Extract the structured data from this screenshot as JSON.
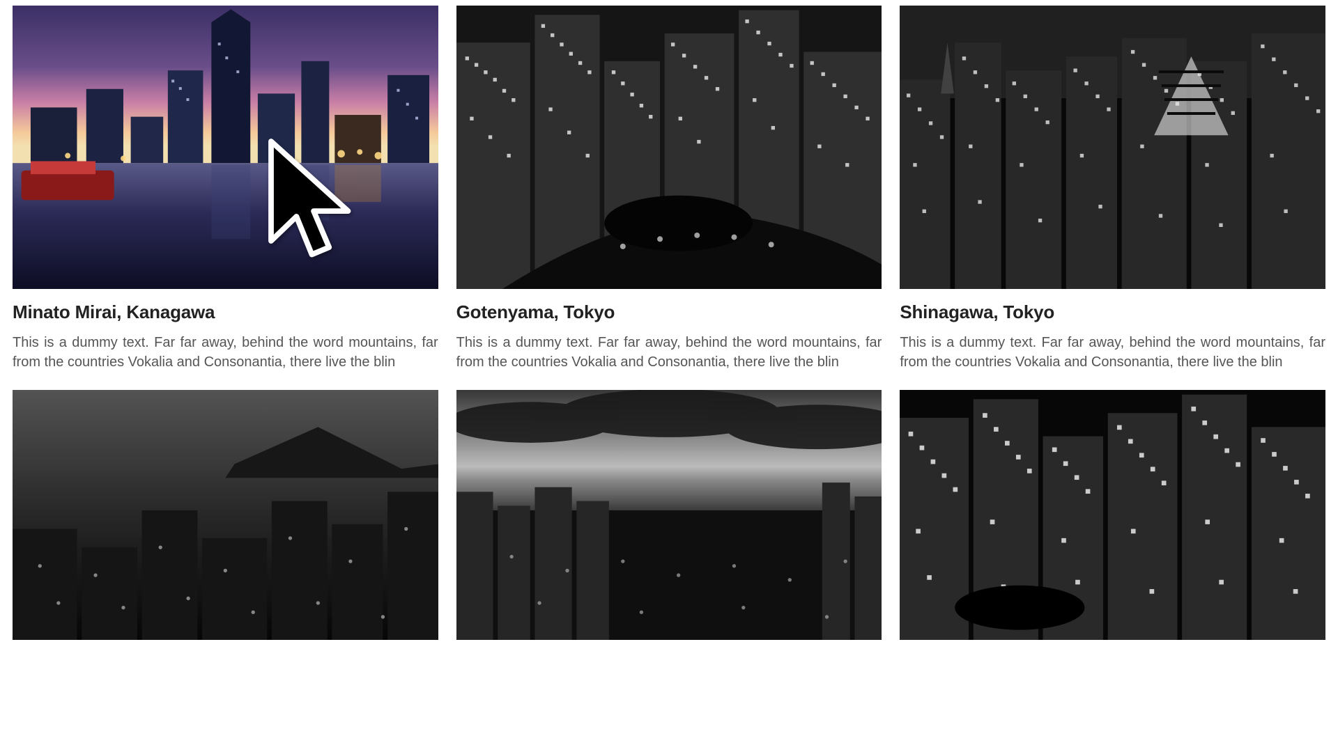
{
  "cards": [
    {
      "title": "Minato Mirai, Kanagawa",
      "desc": "This is a dummy text. Far far away, behind the word mountains, far from the countries Vokalia and Consonantia, there live the blin"
    },
    {
      "title": "Gotenyama, Tokyo",
      "desc": "This is a dummy text. Far far away, behind the word mountains, far from the countries Vokalia and Consonantia, there live the blin"
    },
    {
      "title": "Shinagawa, Tokyo",
      "desc": "This is a dummy text. Far far away, behind the word mountains, far from the countries Vokalia and Consonantia, there live the blin"
    }
  ]
}
